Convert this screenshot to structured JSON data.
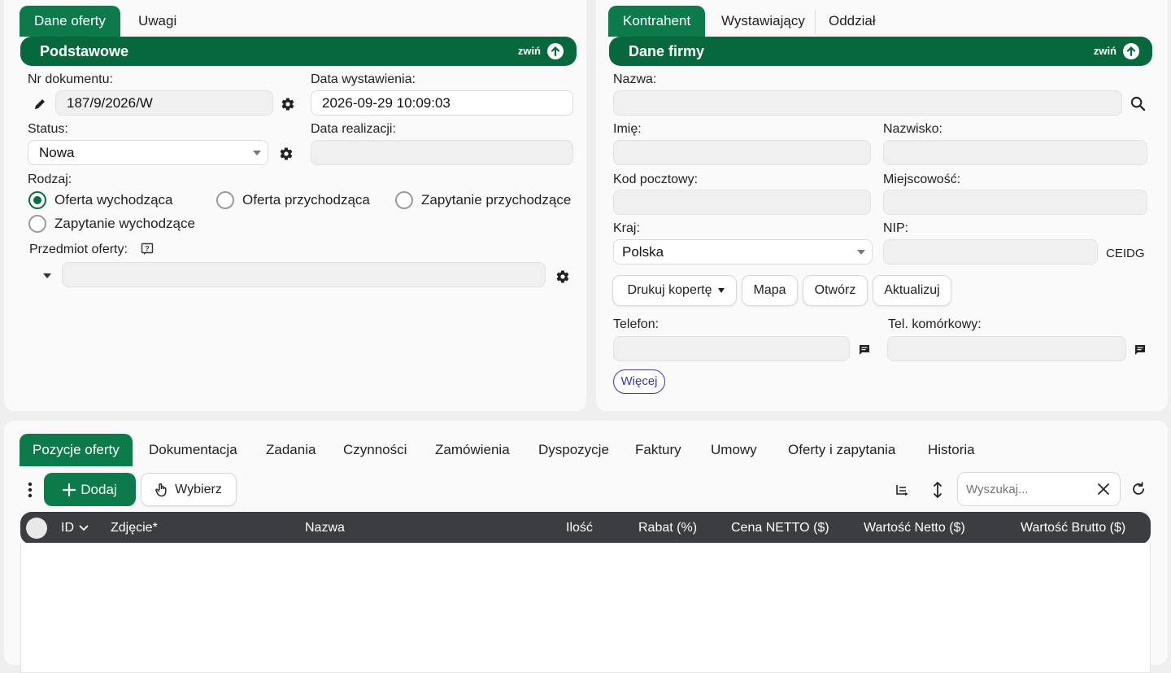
{
  "left_tabs": [
    "Dane oferty",
    "Uwagi"
  ],
  "basic_section": {
    "title": "Podstawowe",
    "collapse_label": "zwiń"
  },
  "doc_number": {
    "label": "Nr dokumentu:",
    "value": "187/9/2026/W"
  },
  "issue_date": {
    "label": "Data wystawienia:",
    "value": "2026-09-29 10:09:03"
  },
  "status": {
    "label": "Status:",
    "value": "Nowa"
  },
  "realization_date": {
    "label": "Data realizacji:",
    "value": ""
  },
  "kind": {
    "label": "Rodzaj:",
    "options": [
      "Oferta wychodząca",
      "Oferta przychodząca",
      "Zapytanie przychodzące",
      "Zapytanie wychodzące"
    ],
    "selected": "Oferta wychodząca"
  },
  "subject": {
    "label": "Przedmiot oferty:",
    "value": ""
  },
  "right_tabs": [
    "Kontrahent",
    "Wystawiający",
    "Oddział"
  ],
  "company_section": {
    "title": "Dane firmy",
    "collapse_label": "zwiń"
  },
  "company": {
    "name_label": "Nazwa:",
    "first_name_label": "Imię:",
    "last_name_label": "Nazwisko:",
    "postal_label": "Kod pocztowy:",
    "city_label": "Miejscowość:",
    "country_label": "Kraj:",
    "country_value": "Polska",
    "nip_label": "NIP:",
    "ceidg_label": "CEIDG",
    "buttons": [
      "Drukuj kopertę",
      "Mapa",
      "Otwórz",
      "Aktualizuj"
    ],
    "phone_label": "Telefon:",
    "mobile_label": "Tel. komórkowy:",
    "more_label": "Więcej"
  },
  "bottom_tabs": [
    "Pozycje oferty",
    "Dokumentacja",
    "Zadania",
    "Czynności",
    "Zamówienia",
    "Dyspozycje",
    "Faktury",
    "Umowy",
    "Oferty i zapytania",
    "Historia"
  ],
  "toolbar": {
    "add_label": "Dodaj",
    "choose_label": "Wybierz",
    "search_placeholder": "Wyszukaj..."
  },
  "table_columns": [
    "ID",
    "Zdjęcie*",
    "Nazwa",
    "Ilość",
    "Rabat (%)",
    "Cena NETTO ($)",
    "Wartość Netto ($)",
    "Wartość Brutto ($)"
  ],
  "colors": {
    "accent": "#0c7a4a",
    "header_dark": "#08683d",
    "table_header": "#3b3d40",
    "link": "#3a3ab0"
  }
}
